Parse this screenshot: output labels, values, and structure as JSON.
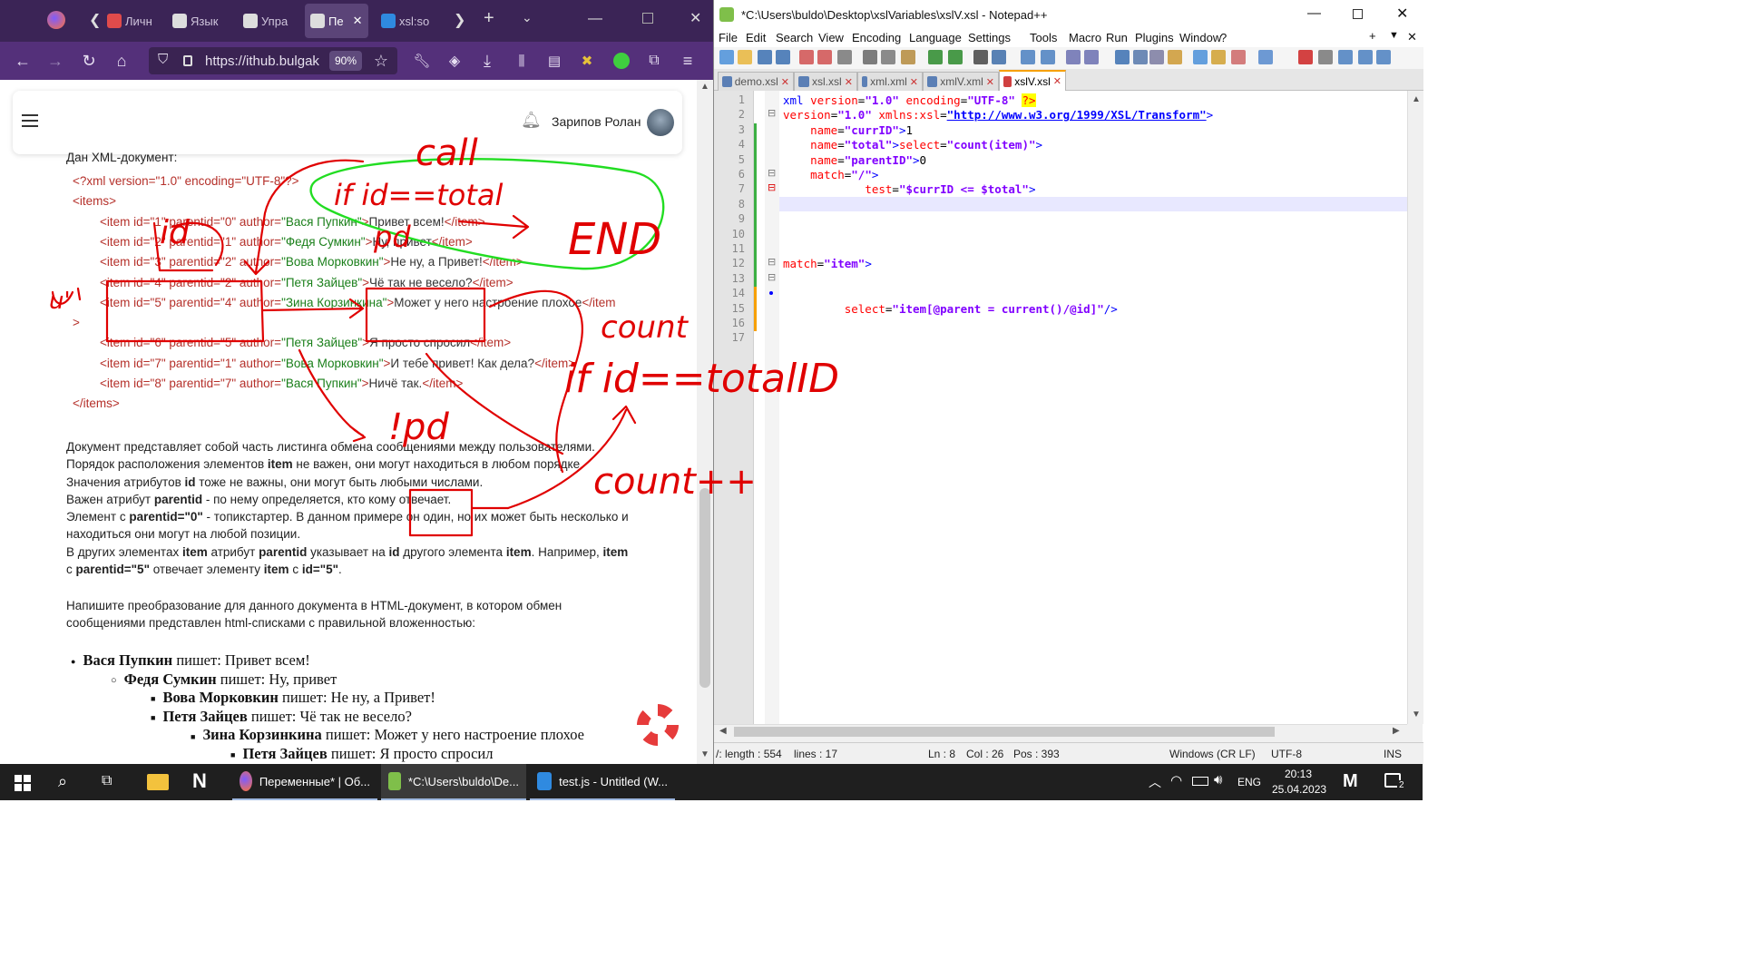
{
  "firefox": {
    "tabs": [
      {
        "label": "Личн"
      },
      {
        "label": "Язык"
      },
      {
        "label": "Упра"
      },
      {
        "label": "Пе"
      },
      {
        "label": "xsl:so"
      }
    ],
    "url": "https://ithub.bulgak",
    "zoom": "90%"
  },
  "page": {
    "user_name": "Зарипов Ролан",
    "intro": "Дан XML-документ:",
    "xml_lines": [
      {
        "tag": "<?xml version=\"1.0\" encoding=\"UTF-8\"?>",
        "indent": false,
        "text": ""
      },
      {
        "tag": "<items>",
        "indent": false,
        "text": ""
      },
      {
        "pre": "<item id=\"1\" parentid=\"0\" author=",
        "author": "\"Вася Пупкин\"",
        "mid": ">",
        "text": "Привет всем!",
        "post": "</item>",
        "indent": true
      },
      {
        "pre": "<item id=\"2\" parentid=\"1\" author=",
        "author": "\"Федя Сумкин\"",
        "mid": ">",
        "text": "Ну, привет",
        "post": "</item>",
        "indent": true
      },
      {
        "pre": "<item id=\"3\" parentid=\"2\" author=",
        "author": "\"Вова Морковкин\"",
        "mid": ">",
        "text": "Не ну, а Привет!",
        "post": "</item>",
        "indent": true
      },
      {
        "pre": "<item id=\"4\" parentid=\"2\" author=",
        "author": "\"Петя Зайцев\"",
        "mid": ">",
        "text": "Чё так не весело?",
        "post": "</item>",
        "indent": true
      },
      {
        "pre": "<item id=\"5\" parentid=\"4\" author=",
        "author": "\"Зина Корзинкина\"",
        "mid": ">",
        "text": "Может у него настроение плохое",
        "post": "</item",
        "indent": true
      }
    ],
    "xml_wrap": ">",
    "xml_lines2": [
      {
        "pre": "<item id=\"6\" parentid=\"5\" author=",
        "author": "\"Петя Зайцев\"",
        "mid": ">",
        "text": "Я просто спросил",
        "post": "</item>"
      },
      {
        "pre": "<item id=\"7\" parentid=\"1\" author=",
        "author": "\"Вова Морковкин\"",
        "mid": ">",
        "text": "И тебе привет! Как дела?",
        "post": "</item>"
      },
      {
        "pre": "<item id=\"8\" parentid=\"7\" author=",
        "author": "\"Вася Пупкин\"",
        "mid": ">",
        "text": "Ничё так.",
        "post": "</item>"
      }
    ],
    "xml_close": "</items>",
    "paragraph": [
      [
        "Документ представляет собой часть листинга обмена сообщениями между пользователями."
      ],
      [
        "Порядок расположения элементов ",
        {
          "b": "item"
        },
        " не важен, они могут находиться в любом порядке."
      ],
      [
        "Значения атрибутов ",
        {
          "b": "id"
        },
        " тоже не важны, они могут быть любыми числами."
      ],
      [
        "Важен атрибут ",
        {
          "b": "parentid"
        },
        " - по нему определяется, кто кому отвечает."
      ],
      [
        "Элемент с ",
        {
          "b": "parentid=\"0\""
        },
        " - топикстартер. В данном примере он один, но их может быть несколько и"
      ],
      [
        "находиться они могут на любой позиции."
      ],
      [
        "В других элементах ",
        {
          "b": "item"
        },
        " атрибут ",
        {
          "b": "parentid"
        },
        " указывает на ",
        {
          "b": "id"
        },
        " другого элемента ",
        {
          "b": "item"
        },
        ". Например, ",
        {
          "b": "item"
        }
      ],
      [
        "с ",
        {
          "b": "parentid=\"5\""
        },
        " отвечает элементу ",
        {
          "b": "item"
        },
        " с ",
        {
          "b": "id=\"5\""
        },
        "."
      ]
    ],
    "task": [
      "Напишите преобразование для данного документа в HTML-документ, в котором обмен",
      "сообщениями представлен html-списками с правильной вложенностью:"
    ],
    "tree": [
      {
        "level": 0,
        "name": "Вася Пупкин",
        "says": " пишет: ",
        "msg": "Привет всем!"
      },
      {
        "level": 1,
        "name": "Федя Сумкин",
        "says": " пишет: ",
        "msg": "Ну, привет"
      },
      {
        "level": 2,
        "name": "Вова Морковкин",
        "says": " пишет: ",
        "msg": "Не ну, а Привет!"
      },
      {
        "level": 2,
        "name": "Петя Зайцев",
        "says": " пишет: ",
        "msg": "Чё так не весело?"
      },
      {
        "level": 3,
        "name": "Зина Корзинкина",
        "says": " пишет: ",
        "msg": "Может у него настроение плохое"
      },
      {
        "level": 4,
        "name": "Петя Зайцев",
        "says": " пишет: ",
        "msg": "Я просто спросил"
      }
    ]
  },
  "annotations": {
    "call": "call",
    "if_total": "if id==total",
    "end": "END",
    "id_eq": "id",
    "pd": "pd",
    "ud": "u'",
    "count": "count",
    "if_total_id": "if id==totalID",
    "not_pd": "!pd",
    "count_inc": "count++"
  },
  "notepad": {
    "title": "*C:\\Users\\buldo\\Desktop\\xslVariables\\xslV.xsl - Notepad++",
    "menu": [
      "File",
      "Edit",
      "Search",
      "View",
      "Encoding",
      "Language",
      "Settings",
      "Tools",
      "Macro",
      "Run",
      "Plugins",
      "Window",
      "?"
    ],
    "tabs": [
      {
        "label": "demo.xsl"
      },
      {
        "label": "xsl.xsl"
      },
      {
        "label": "xml.xml"
      },
      {
        "label": "xmlV.xml"
      },
      {
        "label": "xslV.xsl"
      }
    ],
    "status": {
      "length": "/: length : 554",
      "lines": "lines : 17",
      "ln": "Ln : 8",
      "col": "Col : 26",
      "pos": "Pos : 393",
      "eol": "Windows (CR LF)",
      "enc": "UTF-8",
      "mode": "INS"
    }
  },
  "taskbar": {
    "apps": [
      {
        "label": "Переменные* | Об..."
      },
      {
        "label": "*C:\\Users\\buldo\\De..."
      },
      {
        "label": "test.js - Untitled (W..."
      }
    ],
    "lang": "ENG",
    "time": "20:13",
    "date": "25.04.2023",
    "notif_count": "2"
  },
  "colors": {
    "ink_red": "#e00000",
    "ink_green": "#22dd22",
    "ff_purple": "#54307a",
    "npp_tab_accent": "#f7a000"
  }
}
